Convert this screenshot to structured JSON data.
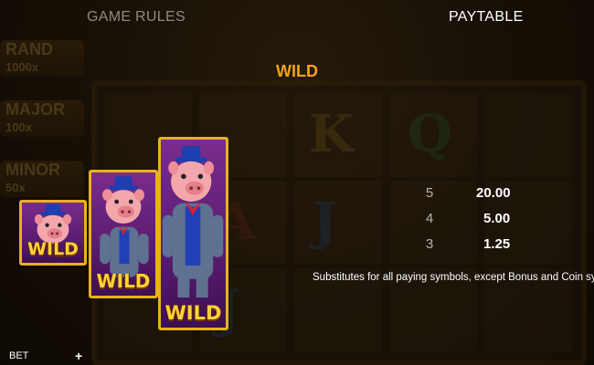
{
  "tabs": [
    {
      "label": "GAME RULES",
      "active": false
    },
    {
      "label": "PAYTABLE",
      "active": true
    }
  ],
  "section": {
    "title": "WILD"
  },
  "symbols": [
    {
      "label": "WILD",
      "icon": "pig-wild-small-icon"
    },
    {
      "label": "WILD",
      "icon": "pig-wild-medium-icon"
    },
    {
      "label": "WILD",
      "icon": "pig-wild-large-icon"
    }
  ],
  "paytable": [
    {
      "count": "5",
      "value": "20.00"
    },
    {
      "count": "4",
      "value": "5.00"
    },
    {
      "count": "3",
      "value": "1.25"
    }
  ],
  "description": "Substitutes for all paying symbols, except Bonus and Coin sym",
  "background": {
    "jackpots": [
      "RAND",
      "MAJOR",
      "MINOR"
    ],
    "jackpot_multipliers": [
      "1000x",
      "100x",
      "50x"
    ]
  },
  "footer": {
    "bet_label": "BET"
  },
  "colors": {
    "accent": "#f5a31a",
    "card_border": "#e8b21c",
    "card_bg": "#5a1c70",
    "wild_text": "#ffd23a"
  }
}
